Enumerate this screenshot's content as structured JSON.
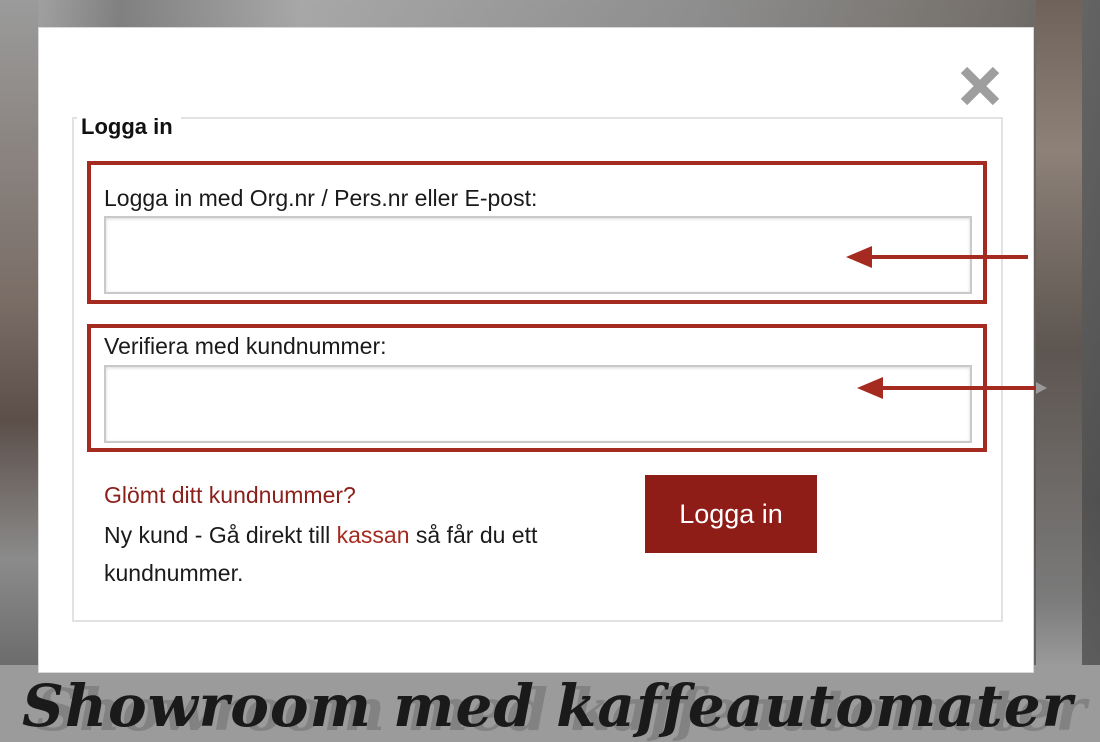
{
  "background": {
    "banner_text": "Showroom med kaffeautomater"
  },
  "modal": {
    "close_icon": "close-icon",
    "title": "Logga in",
    "login_field": {
      "label": "Logga in med Org.nr / Pers.nr eller E-post:",
      "value": "",
      "placeholder": ""
    },
    "verify_field": {
      "label": "Verifiera med kundnummer:",
      "value": "",
      "placeholder": ""
    },
    "forgot_link": "Glömt ditt kundnummer?",
    "new_customer": {
      "prefix": "Ny kund - Gå direkt till ",
      "link": "kassan",
      "suffix": " så får du ett kundnummer."
    },
    "submit_label": "Logga in"
  },
  "colors": {
    "accent": "#8e1c17",
    "highlight_border": "#a52a1f",
    "link": "#8b1f1a"
  }
}
